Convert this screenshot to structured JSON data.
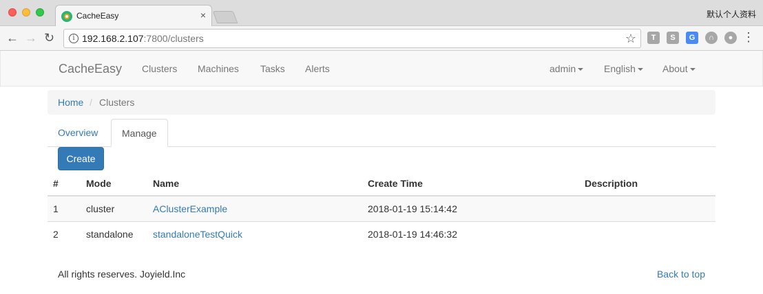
{
  "browser": {
    "tab_title": "CacheEasy",
    "tab_close": "×",
    "profile_name": "默认个人资料",
    "url_host": "192.168.2.107",
    "url_rest": ":7800/clusters",
    "back": "←",
    "forward": "→",
    "reload": "↻",
    "star": "☆",
    "menu": "⋮",
    "info_glyph": "i",
    "extensions": [
      {
        "name": "text-ext-icon",
        "glyph": "T"
      },
      {
        "name": "shield-ext-icon",
        "glyph": "S"
      },
      {
        "name": "translate-ext-icon",
        "glyph": "G"
      },
      {
        "name": "ghost-ext-icon",
        "glyph": "∩"
      },
      {
        "name": "globe-ext-icon",
        "glyph": "●"
      }
    ]
  },
  "navbar": {
    "brand": "CacheEasy",
    "links": [
      "Clusters",
      "Machines",
      "Tasks",
      "Alerts"
    ],
    "right": [
      "admin",
      "English",
      "About"
    ]
  },
  "breadcrumb": {
    "home": "Home",
    "separator": "/",
    "current": "Clusters"
  },
  "tabs": [
    "Overview",
    "Manage"
  ],
  "create_button": "Create",
  "table": {
    "headers": [
      "#",
      "Mode",
      "Name",
      "Create Time",
      "Description"
    ],
    "rows": [
      {
        "id": "1",
        "mode": "cluster",
        "name": "AClusterExample",
        "time": "2018-01-19 15:14:42",
        "description": ""
      },
      {
        "id": "2",
        "mode": "standalone",
        "name": "standaloneTestQuick",
        "time": "2018-01-19 14:46:32",
        "description": ""
      }
    ]
  },
  "footer": {
    "copyright": "All rights reserves. Joyield.Inc",
    "back_to_top": "Back to top"
  },
  "colors": {
    "link": "#337ab7",
    "primary_button": "#337ab7",
    "navbar_bg": "#f8f8f8"
  }
}
